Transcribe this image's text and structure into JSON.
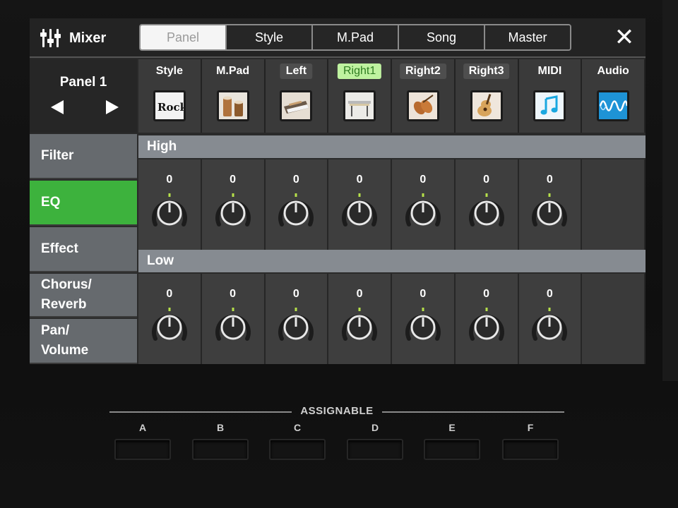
{
  "app": {
    "title": "Mixer"
  },
  "tabs": [
    {
      "label": "Panel",
      "active": true
    },
    {
      "label": "Style",
      "active": false
    },
    {
      "label": "M.Pad",
      "active": false
    },
    {
      "label": "Song",
      "active": false
    },
    {
      "label": "Master",
      "active": false
    }
  ],
  "close": {
    "label": "✕"
  },
  "panel": {
    "label": "Panel 1"
  },
  "channels": [
    {
      "label": "Style",
      "icon": "rock-style-icon",
      "icon_text": "Rock"
    },
    {
      "label": "M.Pad",
      "icon": "drum-icon"
    },
    {
      "label": "Left",
      "icon": "synth-keyboard-icon"
    },
    {
      "label": "Right1",
      "icon": "vibraphone-icon",
      "selected": true
    },
    {
      "label": "Right2",
      "icon": "string-ensemble-icon"
    },
    {
      "label": "Right3",
      "icon": "acoustic-guitar-icon"
    },
    {
      "label": "MIDI",
      "icon": "music-note-icon"
    },
    {
      "label": "Audio",
      "icon": "waveform-icon"
    }
  ],
  "menu": [
    {
      "label": "Filter"
    },
    {
      "label": "EQ",
      "active": true
    },
    {
      "label": "Effect"
    },
    {
      "label": "Chorus/\nReverb"
    },
    {
      "label": "Pan/\nVolume"
    }
  ],
  "eq": {
    "high": {
      "label": "High",
      "values": [
        "0",
        "0",
        "0",
        "0",
        "0",
        "0",
        "0"
      ]
    },
    "low": {
      "label": "Low",
      "values": [
        "0",
        "0",
        "0",
        "0",
        "0",
        "0",
        "0"
      ]
    }
  },
  "hardware": {
    "assignable_label": "ASSIGNABLE",
    "buttons": [
      "A",
      "B",
      "C",
      "D",
      "E",
      "F"
    ]
  },
  "colors": {
    "active_menu": "#3db23d",
    "selected_channel_bg": "#bff2a0",
    "knob_indicator": "#b6e04a"
  }
}
